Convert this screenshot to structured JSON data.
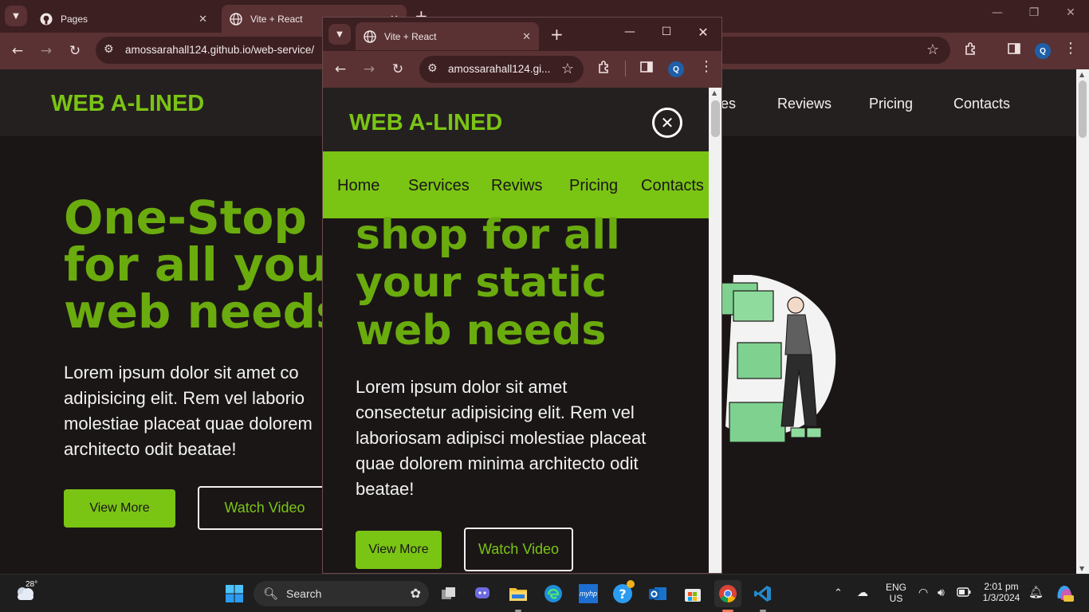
{
  "main_browser": {
    "tabs": [
      {
        "title": "Pages",
        "close": "✕"
      },
      {
        "title": "Vite + React",
        "close": "✕"
      }
    ],
    "new_tab": "+",
    "url": "amossarahall124.github.io/web-service/",
    "page": {
      "logo": "WEB A-LINED",
      "nav": [
        "es",
        "Reviews",
        "Pricing",
        "Contacts"
      ],
      "hero_title": "One-Stop sh for all your web needs",
      "hero_title_lines": [
        "One-Stop sh",
        "for all your",
        "web needs"
      ],
      "hero_text_lines": [
        "Lorem ipsum dolor sit amet co",
        "adipisicing elit. Rem vel laborio",
        "molestiae placeat quae dolorem",
        "architecto odit beatae!"
      ],
      "view_more": "View More",
      "watch_video": "Watch Video"
    }
  },
  "popup_browser": {
    "tab_title": "Vite + React",
    "tab_close": "✕",
    "new_tab": "+",
    "url": "amossarahall124.gi...",
    "avatar": "Q",
    "page": {
      "logo": "WEB A-LINED",
      "close_icon": "✕",
      "nav": [
        "Home",
        "Services",
        "Reviws",
        "Pricing",
        "Contacts"
      ],
      "hero_title_lines": [
        "shop for all",
        "your static",
        "web needs"
      ],
      "hero_text_lines": [
        "Lorem ipsum dolor sit amet",
        "consectetur adipisicing elit. Rem vel",
        "laboriosam adipisci molestiae placeat",
        "quae dolorem minima architecto odit",
        "beatae!"
      ],
      "view_more": "View More",
      "watch_video": "Watch Video"
    }
  },
  "toolbar": {
    "avatar": "Q"
  },
  "taskbar": {
    "weather_temp": "28°",
    "search_placeholder": "Search",
    "language": "ENG",
    "region": "US",
    "time": "2:01 pm",
    "date": "1/3/2024"
  },
  "colors": {
    "accent_green": "#7ac414",
    "title_green": "#6aab0e",
    "chrome_dark": "#3c1f21",
    "chrome_toolbar": "#5a3234",
    "page_bg": "#1b1616"
  }
}
